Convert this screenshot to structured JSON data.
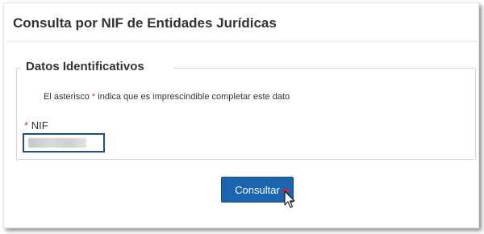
{
  "page": {
    "title": "Consulta por NIF de Entidades Jurídicas"
  },
  "form": {
    "legend": "Datos Identificativos",
    "required_note": {
      "prefix": "El asterisco ",
      "asterisk": "*",
      "suffix": " indica que es imprescindible completar este dato"
    },
    "nif": {
      "asterisk": "*",
      "label": "NIF",
      "value_redacted": true
    },
    "submit_label": "Consultar"
  },
  "colors": {
    "button_bg": "#1a64b0",
    "input_border": "#1d4f8f",
    "asterisk": "#d9342b",
    "cursor_click_dot": "#e02020"
  },
  "icons": {
    "cursor": "mouse-pointer-arrow-icon"
  }
}
